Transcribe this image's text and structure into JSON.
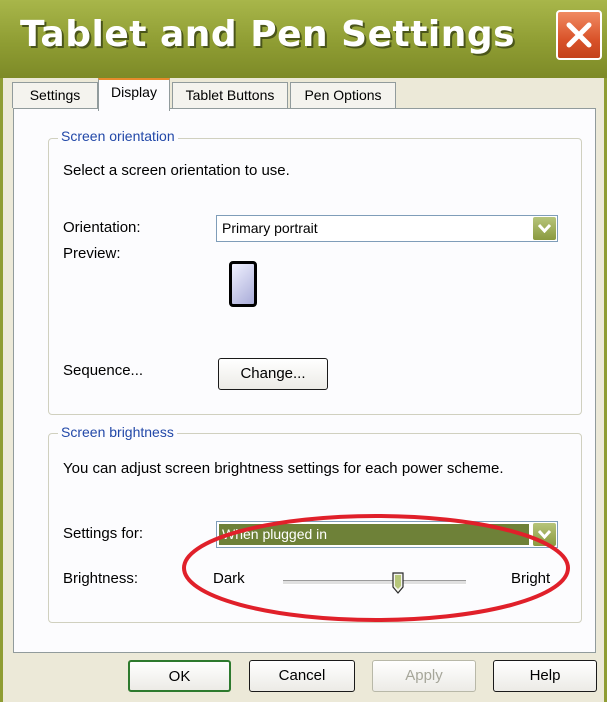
{
  "window": {
    "title": "Tablet and Pen Settings"
  },
  "tabs": [
    {
      "label": "Settings",
      "active": false
    },
    {
      "label": "Display",
      "active": true
    },
    {
      "label": "Tablet Buttons",
      "active": false
    },
    {
      "label": "Pen Options",
      "active": false
    }
  ],
  "screen_orientation": {
    "legend": "Screen orientation",
    "instruction": "Select a screen orientation to use.",
    "orientation_label": "Orientation:",
    "orientation_value": "Primary portrait",
    "preview_label": "Preview:",
    "sequence_label": "Sequence...",
    "change_button": "Change..."
  },
  "screen_brightness": {
    "legend": "Screen brightness",
    "instruction": "You can adjust screen brightness settings for each power scheme.",
    "settings_for_label": "Settings for:",
    "settings_for_value": "When plugged in",
    "brightness_label": "Brightness:",
    "dark_label": "Dark",
    "bright_label": "Bright",
    "brightness_level": 0.63
  },
  "buttons": {
    "ok": "OK",
    "cancel": "Cancel",
    "apply": "Apply",
    "help": "Help"
  },
  "colors": {
    "titlebar": "#8f9d33",
    "highlight_ellipse": "#e0202a",
    "selection": "#6e8138",
    "close_button": "#d9532a"
  },
  "icons": {
    "close": "close-icon",
    "dropdown": "chevron-down-icon",
    "preview": "portrait-screen-icon",
    "slider_thumb": "slider-thumb"
  }
}
